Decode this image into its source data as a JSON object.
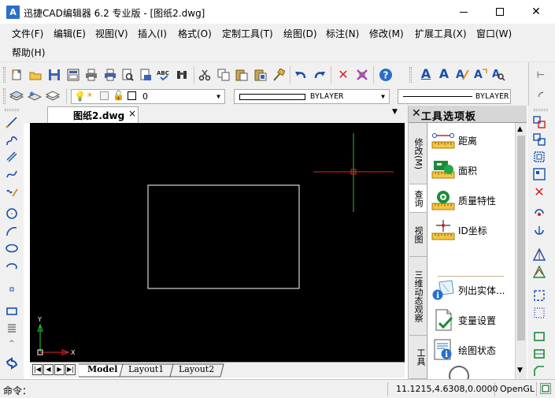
{
  "window": {
    "title": "迅捷CAD编辑器 6.2 专业版  - [图纸2.dwg]",
    "app_icon_letter": "A",
    "controls": [
      "minimize",
      "maximize",
      "close"
    ]
  },
  "menu": {
    "items": [
      {
        "label": "文件(F)"
      },
      {
        "label": "编辑(E)"
      },
      {
        "label": "视图(V)"
      },
      {
        "label": "插入(I)"
      },
      {
        "label": "格式(O)"
      },
      {
        "label": "定制工具(T)"
      },
      {
        "label": "绘图(D)"
      },
      {
        "label": "标注(N)"
      },
      {
        "label": "修改(M)"
      },
      {
        "label": "扩展工具(X)"
      },
      {
        "label": "窗口(W)"
      },
      {
        "label": "帮助(H)"
      }
    ]
  },
  "toolbar2": {
    "layer_value": "0",
    "linetype_value": "BYLAYER",
    "lineweight_value": "BYLAYER"
  },
  "document": {
    "tab_label": "图纸2.dwg",
    "tab_close": "×"
  },
  "canvas": {
    "ucs_y_label": "Y",
    "ucs_x_label": "X"
  },
  "layouts": {
    "tabs": [
      "Model",
      "Layout1",
      "Layout2"
    ],
    "active": "Model"
  },
  "palette": {
    "title": "工具选项板",
    "tabs": [
      "修改(M)",
      "查询",
      "视图",
      "三维动态观察",
      "工具"
    ],
    "active_tab": "查询",
    "items": [
      {
        "label": "距离",
        "icon": "distance-icon"
      },
      {
        "label": "面积",
        "icon": "area-icon"
      },
      {
        "label": "质量特性",
        "icon": "mass-properties-icon"
      },
      {
        "label": "ID坐标",
        "icon": "id-point-icon"
      },
      {
        "label": "列出实体...",
        "icon": "list-entities-icon"
      },
      {
        "label": "变量设置",
        "icon": "set-variable-icon"
      },
      {
        "label": "绘图状态",
        "icon": "drawing-status-icon"
      }
    ]
  },
  "status": {
    "command_label": "命令：",
    "coordinates": "11.1215,4.6308,0.0000",
    "render_mode": "OpenGL"
  },
  "colors": {
    "canvas_bg": "#000000",
    "crosshair_h": "#e8271b",
    "crosshair_v": "#3ab53a",
    "rectangle": "#ffffff",
    "ucs_y": "#2fd12f",
    "ucs_x": "#e8271b",
    "chrome_bg": "#f0f0f0",
    "icon_blue": "#1a4fae"
  }
}
